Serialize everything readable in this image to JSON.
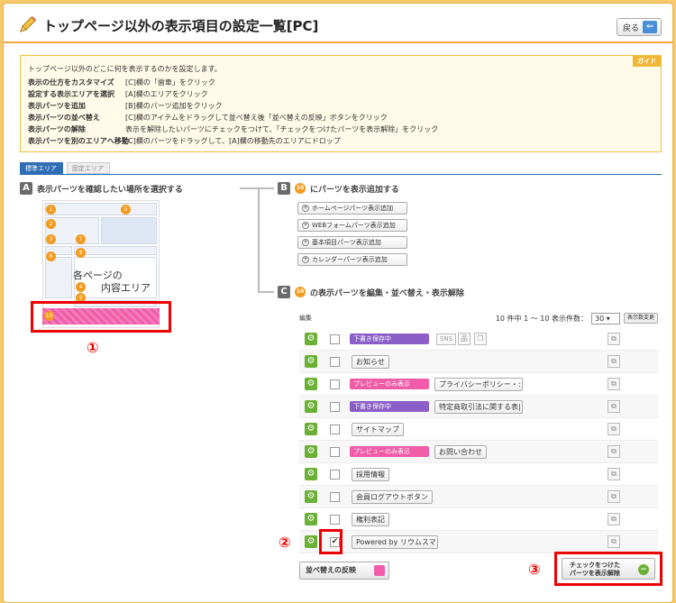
{
  "header": {
    "title": "トップページ以外の表示項目の設定一覧[PC]",
    "back_label": "戻る"
  },
  "guide": {
    "tag": "ガイド",
    "intro": "トップページ以外のどこに何を表示するのかを設定します。",
    "rows": [
      {
        "key": "表示の仕方をカスタマイズ",
        "val": "[C]欄の「歯車」をクリック"
      },
      {
        "key": "設定する表示エリアを選択",
        "val": "[A]欄のエリアをクリック"
      },
      {
        "key": "表示パーツを追加",
        "val": "[B]欄のパーツ追加をクリック"
      },
      {
        "key": "表示パーツの並べ替え",
        "val": "[C]欄のアイテムをドラッグして並べ替え後「並べ替えの反映」ボタンをクリック"
      },
      {
        "key": "表示パーツの解除",
        "val": "表示を解除したいパーツにチェックをつけて、「チェックをつけたパーツを表示解除」をクリック"
      },
      {
        "key": "表示パーツを別のエリアへ移動",
        "val": "[C]欄のパーツをドラッグして、[A]欄の移動先のエリアにドロップ"
      }
    ]
  },
  "tabs": {
    "standard": "標準エリア",
    "fixed": "固定エリア"
  },
  "sectionA": {
    "letter": "A",
    "title": "表示パーツを確認したい場所を選択する"
  },
  "sectionB": {
    "letter": "B",
    "badge": "10",
    "title": "にパーツを表示追加する",
    "buttons": [
      "ホームページパーツ表示追加",
      "WEBフォームパーツ表示追加",
      "基本項目パーツ表示追加",
      "カレンダーパーツ表示追加"
    ]
  },
  "sectionC": {
    "letter": "C",
    "badge": "10",
    "title": "の表示パーツを編集・並べ替え・表示解除"
  },
  "thumb": {
    "text_line1": "各ページの",
    "text_line2": "内容エリア",
    "highlight_num": "10",
    "nums": [
      "1",
      "2",
      "3",
      "4",
      "5",
      "6",
      "7",
      "8",
      "9"
    ]
  },
  "table": {
    "edit_label": "編集",
    "count_text": "10 件中 1 〜 10  表示件数：",
    "per_page": "30",
    "change_label": "表示数変更",
    "rows": [
      {
        "badge": "下書き保存中",
        "badge_type": "draft",
        "name": "",
        "sns": "SNS",
        "checked": false
      },
      {
        "badge": "",
        "badge_type": "",
        "name": "お知らせ",
        "checked": false
      },
      {
        "badge": "プレビューのみ表示",
        "badge_type": "preview",
        "name": "プライバシーポリシー・:",
        "checked": false
      },
      {
        "badge": "下書き保存中",
        "badge_type": "draft",
        "name": "特定商取引法に関する表|",
        "checked": false
      },
      {
        "badge": "",
        "badge_type": "",
        "name": "サイトマップ",
        "checked": false
      },
      {
        "badge": "プレビューのみ表示",
        "badge_type": "preview",
        "name": "お問い合わせ",
        "checked": false
      },
      {
        "badge": "",
        "badge_type": "",
        "name": "採用情報",
        "checked": false
      },
      {
        "badge": "",
        "badge_type": "",
        "name": "会員ログアウトボタン",
        "checked": false
      },
      {
        "badge": "",
        "badge_type": "",
        "name": "権利表記",
        "checked": false
      },
      {
        "badge": "",
        "badge_type": "",
        "name": "Powered by リウムスマ･",
        "checked": true
      }
    ],
    "reflect_label": "並べ替えの反映",
    "hide_label_1": "チェックをつけた",
    "hide_label_2": "パーツを表示解除"
  },
  "markers": {
    "m1": "①",
    "m2": "②",
    "m3": "③"
  },
  "colors": {
    "accent": "#f2a73a",
    "tab_active": "#2f6db5",
    "gear": "#6ab034",
    "draft": "#8b5fc7",
    "preview": "#f05ca8",
    "highlight": "#e00000"
  }
}
